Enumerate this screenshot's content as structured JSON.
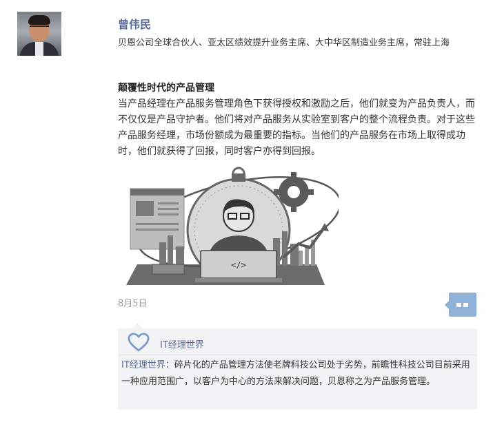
{
  "author": {
    "name": "曾伟民",
    "title": "贝恩公司全球合伙人、亚太区绩效提升业务主席、大中华区制造业务主席，常驻上海"
  },
  "article": {
    "title": "颠覆性时代的产品管理",
    "body": "当产品经理在产品服务管理角色下获得授权和激励之后，他们就变为产品负责人，而不仅仅是产品守护者。他们将对产品服务从实验室到客户的整个流程负责。对于这些产品服务经理，市场份额成为最重要的指标。当他们的产品服务在市场上取得成功时，他们就获得了回报，同时客户亦得到回报。",
    "illustration_icon": "product-manager-illustration",
    "laptop_code": "</>",
    "date": "8月5日"
  },
  "comment_button": {
    "icon": "comment-icon",
    "color": "#8fb3d8"
  },
  "likes": {
    "icon": "heart-icon",
    "liker": "IT经理世界",
    "background": "#f3f3f5"
  },
  "comment": {
    "author": "IT经理世界",
    "separator": "：",
    "text": "碎片化的产品管理方法使老牌科技公司处于劣势，前瞻性科技公司目前采用一种应用范围广，以客户为中心的方法来解决问题，贝恩称之为产品服务管理。"
  },
  "colors": {
    "link": "#576b95",
    "text": "#353535",
    "muted": "#9b9b9b"
  }
}
